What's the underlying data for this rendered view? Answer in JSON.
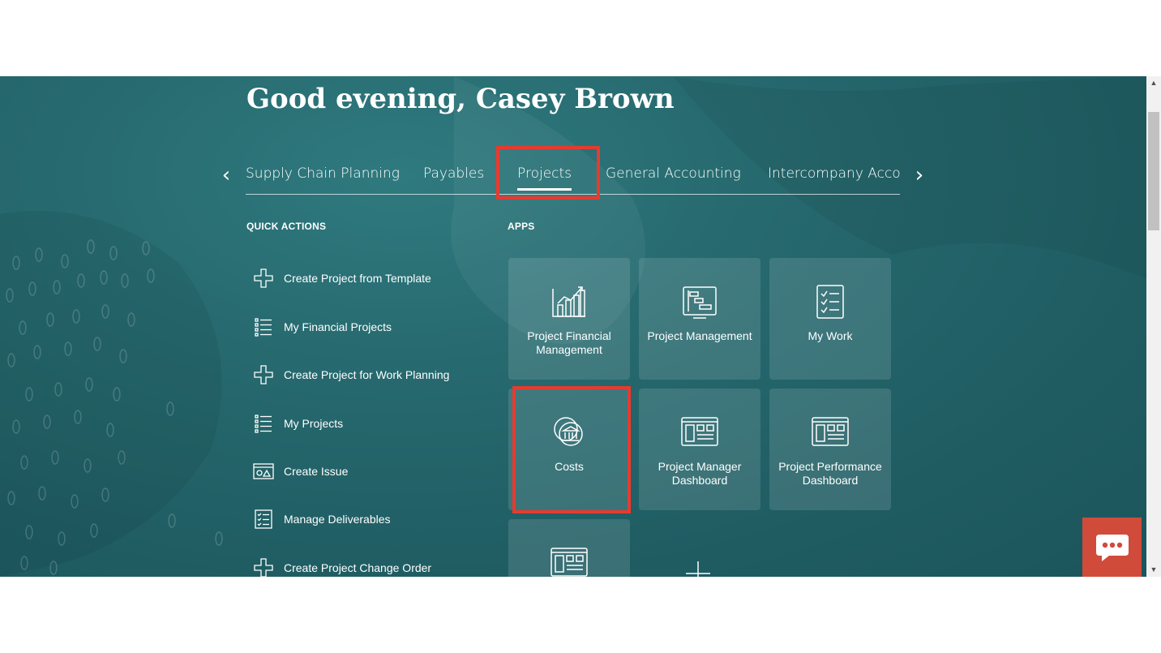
{
  "greeting": "Good evening, Casey Brown",
  "tabs": [
    {
      "label": "Supply Chain Planning"
    },
    {
      "label": "Payables"
    },
    {
      "label": "Projects"
    },
    {
      "label": "General Accounting"
    },
    {
      "label": "Intercompany Accour"
    }
  ],
  "active_tab": "Projects",
  "quick_actions": {
    "heading": "QUICK ACTIONS",
    "items": [
      {
        "label": "Create Project from Template",
        "icon": "plus-icon"
      },
      {
        "label": "My Financial Projects",
        "icon": "list-icon"
      },
      {
        "label": "Create Project for Work Planning",
        "icon": "plus-icon"
      },
      {
        "label": "My Projects",
        "icon": "list-icon"
      },
      {
        "label": "Create Issue",
        "icon": "issue-icon"
      },
      {
        "label": "Manage Deliverables",
        "icon": "checklist-icon"
      },
      {
        "label": "Create Project Change Order",
        "icon": "plus-icon"
      }
    ]
  },
  "apps": {
    "heading": "APPS",
    "tiles": [
      {
        "label": "Project Financial Management",
        "icon": "financial-chart-icon"
      },
      {
        "label": "Project Management",
        "icon": "gantt-icon"
      },
      {
        "label": "My Work",
        "icon": "checklist-icon"
      },
      {
        "label": "Costs",
        "icon": "bank-coins-icon"
      },
      {
        "label": "Project Manager Dashboard",
        "icon": "dashboard-icon"
      },
      {
        "label": "Project Performance Dashboard",
        "icon": "dashboard-icon"
      },
      {
        "label": "",
        "icon": "dashboard-icon"
      }
    ]
  },
  "colors": {
    "background": "#26696e",
    "highlight": "#e83a2f",
    "chat": "#d14b3b"
  }
}
